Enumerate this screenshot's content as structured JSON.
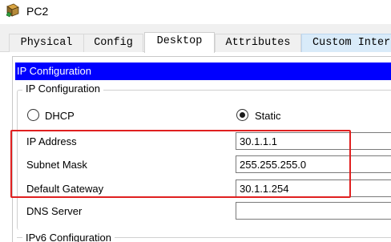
{
  "window": {
    "title": "PC2",
    "icon": "pc-device-icon"
  },
  "tabs": [
    {
      "label": "Physical",
      "active": false
    },
    {
      "label": "Config",
      "active": false
    },
    {
      "label": "Desktop",
      "active": true
    },
    {
      "label": "Attributes",
      "active": false
    },
    {
      "label": "Custom Inter",
      "active": false
    }
  ],
  "panel": {
    "header": "IP Configuration",
    "group_title": "IP Configuration",
    "mode": {
      "dhcp_label": "DHCP",
      "static_label": "Static",
      "selected": "Static"
    },
    "fields": {
      "ip_address": {
        "label": "IP Address",
        "value": "30.1.1.1"
      },
      "subnet_mask": {
        "label": "Subnet Mask",
        "value": "255.255.255.0"
      },
      "default_gateway": {
        "label": "Default Gateway",
        "value": "30.1.1.254"
      },
      "dns_server": {
        "label": "DNS Server",
        "value": ""
      }
    },
    "ipv6_group_title": "IPv6 Configuration"
  },
  "colors": {
    "header_bg": "#0000ff",
    "header_text": "#ffffff",
    "highlight_border": "#e02020",
    "custom_tab_bg": "#d9ebf9"
  }
}
